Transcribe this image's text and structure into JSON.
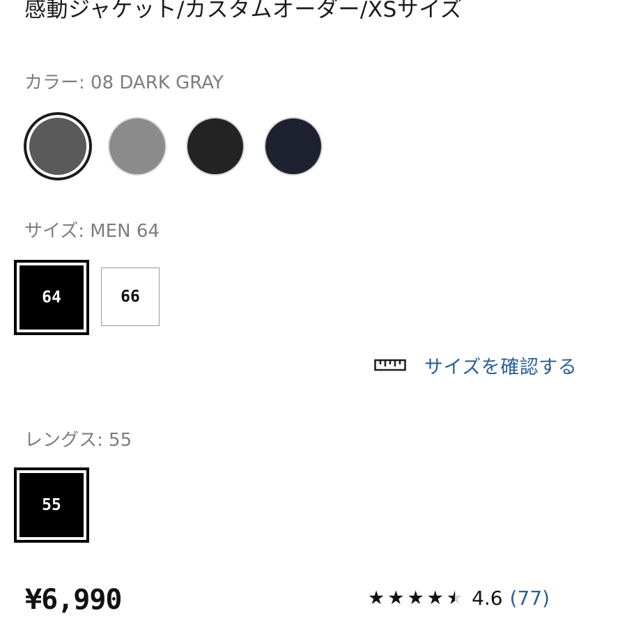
{
  "product": {
    "title": "感動ジャケット/カスタムオーダー/XSサイズ"
  },
  "color_section": {
    "label": "カラー: 08 DARK GRAY",
    "swatches": [
      {
        "name": "dark-gray",
        "hex": "#5a5a5a",
        "selected": true
      },
      {
        "name": "gray",
        "hex": "#8b8b8b",
        "selected": false
      },
      {
        "name": "black",
        "hex": "#232323",
        "selected": false
      },
      {
        "name": "navy",
        "hex": "#1e2230",
        "selected": false
      }
    ]
  },
  "size_section": {
    "label": "サイズ: MEN 64",
    "options": [
      "64",
      "66"
    ],
    "selected": "64"
  },
  "size_check": {
    "icon": "ruler-icon",
    "label": "サイズを確認する"
  },
  "length_section": {
    "label": "レングス: 55",
    "options": [
      "55"
    ],
    "selected": "55"
  },
  "price": "¥6,990",
  "rating": {
    "stars": 4.5,
    "value": "4.6",
    "count": "(77)"
  },
  "colors": {
    "link": "#2d5f90",
    "label_gray": "#7d7d7d",
    "selected_fill": "#000000"
  }
}
